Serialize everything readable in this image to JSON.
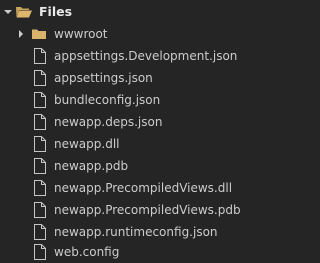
{
  "tree": {
    "root": {
      "label": "Files",
      "expanded": true
    },
    "items": [
      {
        "label": "wwwroot",
        "type": "folder",
        "expanded": false
      },
      {
        "label": "appsettings.Development.json",
        "type": "file"
      },
      {
        "label": "appsettings.json",
        "type": "file"
      },
      {
        "label": "bundleconfig.json",
        "type": "file"
      },
      {
        "label": "newapp.deps.json",
        "type": "file"
      },
      {
        "label": "newapp.dll",
        "type": "file"
      },
      {
        "label": "newapp.pdb",
        "type": "file"
      },
      {
        "label": "newapp.PrecompiledViews.dll",
        "type": "file"
      },
      {
        "label": "newapp.PrecompiledViews.pdb",
        "type": "file"
      },
      {
        "label": "newapp.runtimeconfig.json",
        "type": "file"
      },
      {
        "label": "web.config",
        "type": "file"
      }
    ]
  },
  "icons": {
    "root_chevron": "chevron-down-icon",
    "root_folder": "folder-open-icon",
    "folder_chevron": "chevron-right-icon",
    "folder": "folder-icon",
    "file": "file-icon"
  },
  "colors": {
    "background": "#252526",
    "text": "#cccccc",
    "folder": "#d9b36c",
    "file_icon": "#c5c5c5"
  }
}
